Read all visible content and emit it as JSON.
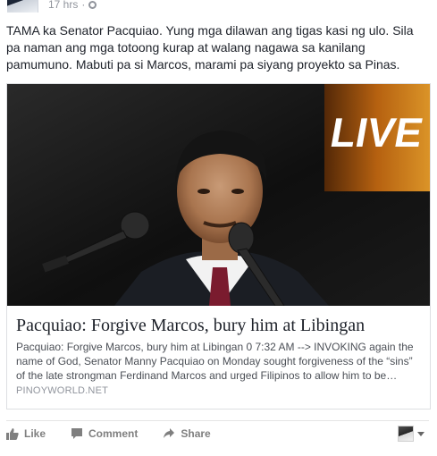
{
  "header": {
    "time": "17 hrs",
    "separator": "·"
  },
  "post": {
    "text": "TAMA ka Senator Pacquiao. Yung mga dilawan ang tigas kasi ng ulo. Sila pa naman ang mga totoong kurap at walang nagawa sa kanilang pamumuno. Mabuti pa si Marcos, marami pa siyang proyekto sa Pinas."
  },
  "link_card": {
    "title": "Pacquiao: Forgive Marcos, bury him at Libingan",
    "description": "Pacquiao: Forgive Marcos, bury him at Libingan 0 7:32 AM --> INVOKING again the name of God, Senator Manny Pacquiao on Monday sought forgiveness of the “sins” of the late strongman Ferdinand Marcos and urged Filipinos to allow him to be…",
    "domain": "PINOYWORLD.NET",
    "image_text": "LIVE"
  },
  "actions": {
    "like": "Like",
    "comment": "Comment",
    "share": "Share"
  },
  "colors": {
    "text": "#1d2129",
    "muted": "#90949c",
    "action": "#7f7f7f",
    "border": "#dddfe2"
  }
}
